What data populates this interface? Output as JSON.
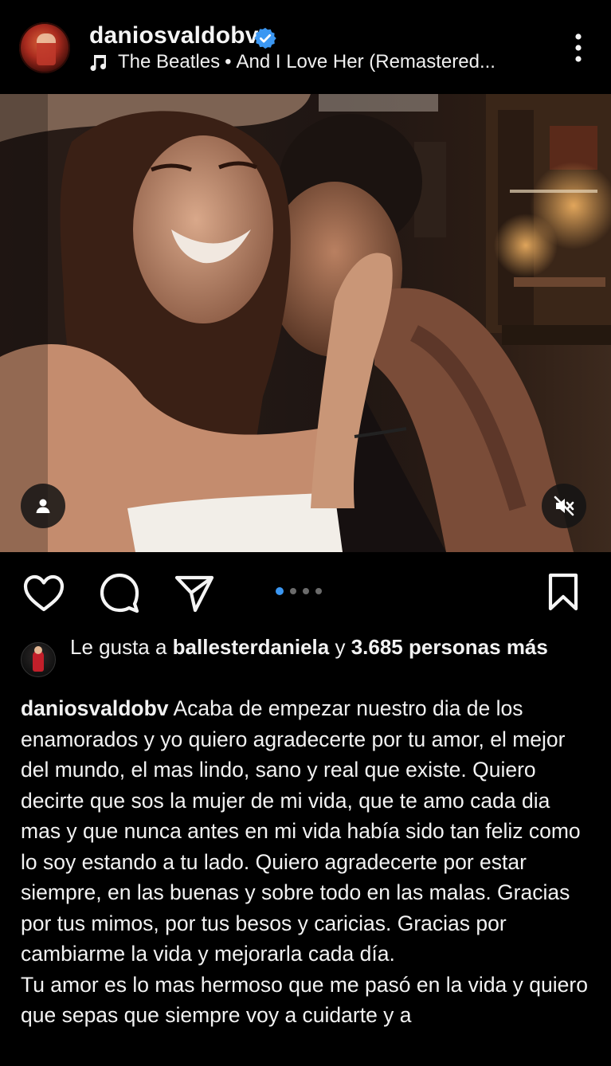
{
  "post": {
    "username": "daniosvaldobv",
    "verified": true,
    "music": {
      "artist": "The Beatles",
      "separator": "•",
      "track": "And I Love Her (Remastered..."
    }
  },
  "media": {
    "carousel_total": 4,
    "carousel_active_index": 0
  },
  "likes": {
    "prefix": "Le gusta a",
    "liker": "ballesterdaniela",
    "connector": "y",
    "count_text": "3.685 personas",
    "suffix": "más"
  },
  "caption": {
    "username": "daniosvaldobv",
    "paragraph_1": "Acaba de empezar nuestro dia de los enamorados y yo quiero agradecerte por tu amor, el mejor del mundo, el mas lindo, sano y real que existe. Quiero decirte que sos la mujer de mi vida, que te amo cada dia mas y que nunca antes en mi vida había sido tan feliz como lo soy estando a tu lado. Quiero agradecerte por estar siempre, en las buenas y sobre todo en las malas. Gracias por tus mimos, por tus besos y caricias. Gracias por cambiarme la vida y mejorarla cada día.",
    "paragraph_2": "Tu amor es lo mas hermoso que me pasó en la vida y quiero que sepas que siempre voy a cuidarte y a"
  },
  "colors": {
    "background": "#000000",
    "text": "#f2f2f2",
    "verified_badge": "#3b97f2",
    "carousel_active_dot": "#3b97f2",
    "carousel_dot": "#6b6b6b"
  },
  "icons": {
    "header_menu": "more-vertical-icon",
    "music": "music-note-icon",
    "verified": "verified-badge-icon",
    "tag": "person-tag-icon",
    "mute": "speaker-muted-icon",
    "like": "heart-icon",
    "comment": "comment-icon",
    "share": "send-icon",
    "save": "bookmark-icon"
  }
}
